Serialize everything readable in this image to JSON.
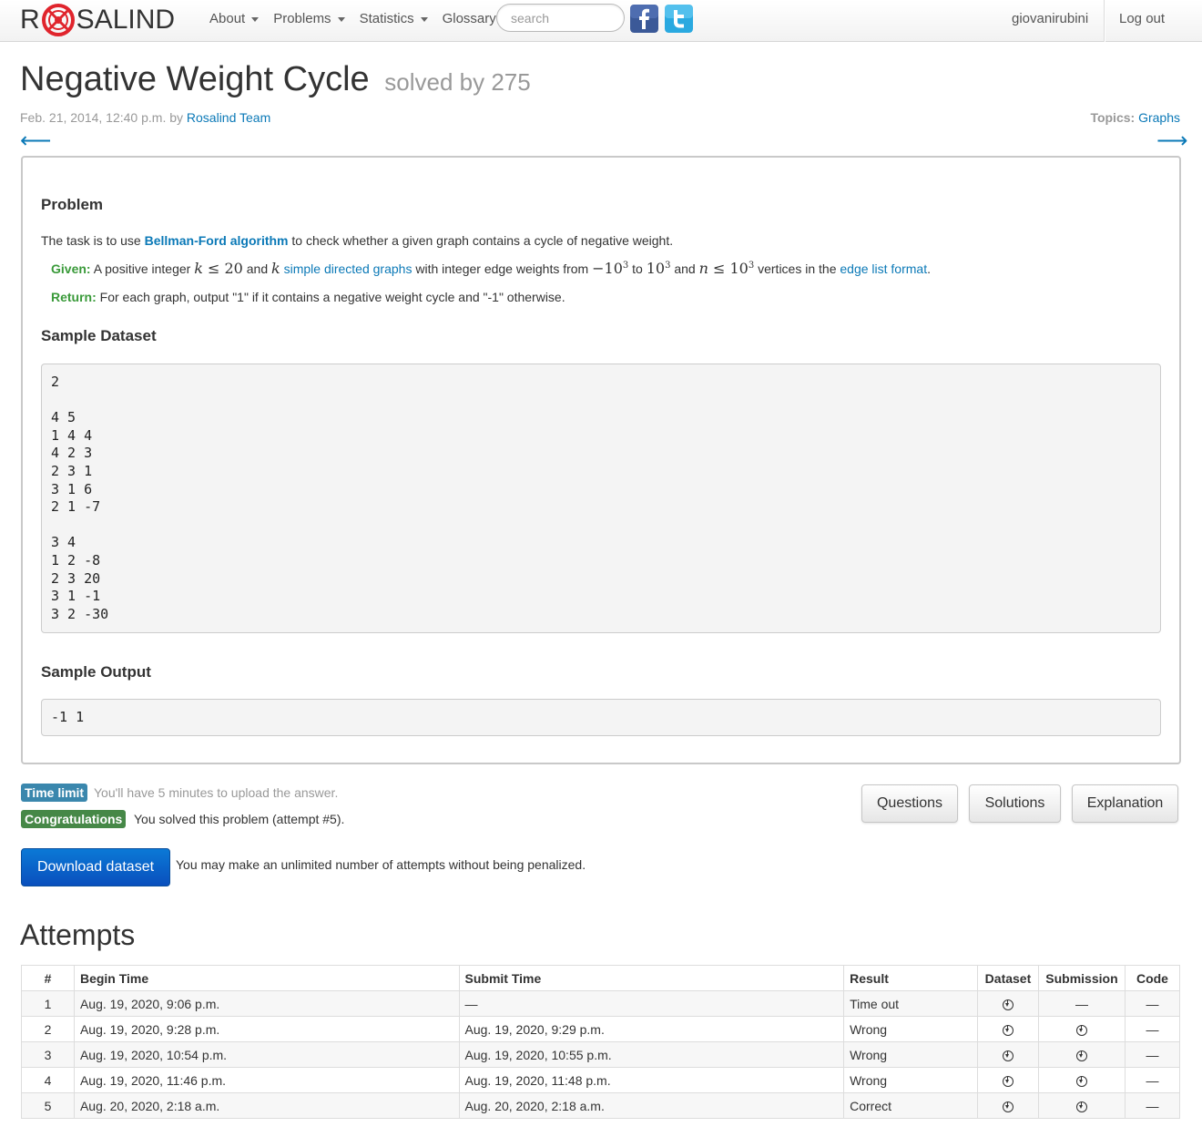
{
  "brand": {
    "letter_r": "R",
    "rest": "SALIND",
    "accent": "#e0242c"
  },
  "nav": {
    "items": [
      {
        "label": "About"
      },
      {
        "label": "Problems"
      },
      {
        "label": "Statistics"
      },
      {
        "label": "Glossary"
      }
    ],
    "search_placeholder": "search",
    "username": "giovanirubini",
    "logout": "Log out",
    "facebook_icon": "facebook-icon",
    "twitter_icon": "twitter-icon"
  },
  "problem": {
    "title": "Negative Weight Cycle",
    "solved_by": "solved by 275",
    "date": "Feb. 21, 2014, 12:40 p.m. by ",
    "author": "Rosalind Team",
    "topics_label": "Topics: ",
    "topic": "Graphs",
    "prev_arrow": "⟵",
    "next_arrow": "⟶",
    "section_problem": "Problem",
    "intro_pre": "The task is to use ",
    "intro_link": "Bellman-Ford algorithm",
    "intro_post": " to check whether a given graph contains a cycle of negative weight.",
    "given_label": "Given:",
    "given_t1": " A positive integer ",
    "given_t2": " and ",
    "given_link1": "simple directed graphs",
    "given_t3": " with integer edge weights from ",
    "given_t4": " to ",
    "given_t5": " and ",
    "given_t6": " vertices in the ",
    "given_link2": "edge list format",
    "given_t7": ".",
    "return_label": "Return:",
    "return_text": " For each graph, output \"1\" if it contains a negative weight cycle and \"-1\" otherwise.",
    "section_dataset": "Sample Dataset",
    "dataset": "2\n\n4 5\n1 4 4\n4 2 3\n2 3 1\n3 1 6\n2 1 -7\n\n3 4\n1 2 -8\n2 3 20\n3 1 -1\n3 2 -30",
    "section_output": "Sample Output",
    "output": "-1 1"
  },
  "status": {
    "time_limit_label": "Time limit",
    "time_limit_text": "You'll have 5 minutes to upload the answer.",
    "congrats_label": "Congratulations",
    "congrats_text": "You solved this problem (attempt #5).",
    "buttons": {
      "questions": "Questions",
      "solutions": "Solutions",
      "explanation": "Explanation"
    },
    "download_label": "Download dataset",
    "download_note": "You may make an unlimited number of attempts without being penalized."
  },
  "attempts": {
    "heading": "Attempts",
    "headers": [
      "#",
      "Begin Time",
      "Submit Time",
      "Result",
      "Dataset",
      "Submission",
      "Code"
    ],
    "rows": [
      {
        "num": "1",
        "begin": "Aug. 19, 2020, 9:06 p.m.",
        "submit": "—",
        "result": "Time out",
        "dataset": true,
        "submission": false,
        "code": "—"
      },
      {
        "num": "2",
        "begin": "Aug. 19, 2020, 9:28 p.m.",
        "submit": "Aug. 19, 2020, 9:29 p.m.",
        "result": "Wrong",
        "dataset": true,
        "submission": true,
        "code": "—"
      },
      {
        "num": "3",
        "begin": "Aug. 19, 2020, 10:54 p.m.",
        "submit": "Aug. 19, 2020, 10:55 p.m.",
        "result": "Wrong",
        "dataset": true,
        "submission": true,
        "code": "—"
      },
      {
        "num": "4",
        "begin": "Aug. 19, 2020, 11:46 p.m.",
        "submit": "Aug. 19, 2020, 11:48 p.m.",
        "result": "Wrong",
        "dataset": true,
        "submission": true,
        "code": "—"
      },
      {
        "num": "5",
        "begin": "Aug. 20, 2020, 2:18 a.m.",
        "submit": "Aug. 20, 2020, 2:18 a.m.",
        "result": "Correct",
        "dataset": true,
        "submission": true,
        "code": "—"
      }
    ],
    "missing": "—"
  }
}
